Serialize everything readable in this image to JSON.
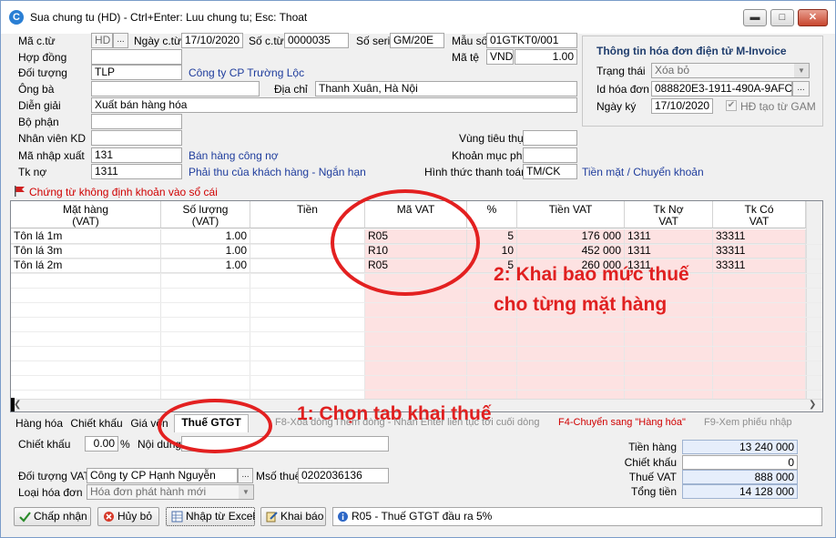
{
  "window": {
    "title": "Sua chung tu (HD) - Ctrl+Enter: Luu chung tu; Esc: Thoat",
    "min": "▬",
    "max": "□",
    "close": "✕"
  },
  "header": {
    "ma_ct_label": "Mã c.từ",
    "ma_ct_value": "HD",
    "dots": "...",
    "ngay_ct_label": "Ngày c.từ",
    "ngay_ct_value": "17/10/2020",
    "so_ct_label": "Số c.từ",
    "so_ct_value": "0000035",
    "so_seri_label": "Số seri",
    "so_seri_value": "GM/20E",
    "mau_so_label": "Mẫu số",
    "mau_so_value": "01GTKT0/001",
    "hop_dong_label": "Hợp đồng",
    "ma_te_label": "Mã tệ",
    "ma_te_value": "VND",
    "ty_gia_value": "1.00",
    "doi_tuong_label": "Đối tượng",
    "doi_tuong_value": "TLP",
    "doi_tuong_name": "Công ty CP Trường Lộc",
    "ong_ba_label": "Ông bà",
    "dia_chi_label": "Địa chỉ",
    "dia_chi_value": "Thanh Xuân, Hà Nội",
    "dien_giai_label": "Diễn giải",
    "dien_giai_value": "Xuất bán hàng hóa",
    "bo_phan_label": "Bộ phận",
    "nhan_vien_label": "Nhân viên KD",
    "vung_tieu_thu_label": "Vùng tiêu thụ",
    "ma_nhap_xuat_label": "Mã nhập xuất",
    "ma_nhap_xuat_value": "131",
    "ma_nhap_xuat_name": "Bán hàng công nợ",
    "khoan_muc_phi_label": "Khoản mục phí",
    "tk_no_label": "Tk nợ",
    "tk_no_value": "1311",
    "tk_no_name": "Phải thu của khách hàng - Ngắn hạn",
    "hinh_thuc_tt_label": "Hình thức thanh toán",
    "hinh_thuc_tt_value": "TM/CK",
    "hinh_thuc_tt_name": "Tiền mặt / Chuyển khoản"
  },
  "einvoice": {
    "title": "Thông tin hóa đơn điện tử M-Invoice",
    "trang_thai_label": "Trạng thái",
    "trang_thai_value": "Xóa bỏ",
    "id_label": "Id hóa đơn",
    "id_value": "088820E3-1911-490A-9AFC-9A",
    "ngay_ky_label": "Ngày ký",
    "ngay_ky_value": "17/10/2020",
    "hd_tao_label": "HĐ tạo từ GAM"
  },
  "warning": "Chứng từ không định khoản vào sổ cái",
  "grid": {
    "columns": [
      {
        "line1": "Mặt hàng",
        "line2": "(VAT)"
      },
      {
        "line1": "Số lượng",
        "line2": "(VAT)"
      },
      {
        "line1": "Tiền",
        "line2": ""
      },
      {
        "line1": "Mã VAT",
        "line2": ""
      },
      {
        "line1": "%",
        "line2": ""
      },
      {
        "line1": "Tiền VAT",
        "line2": ""
      },
      {
        "line1": "Tk Nợ",
        "line2": "VAT"
      },
      {
        "line1": "Tk Có",
        "line2": "VAT"
      }
    ],
    "rows": [
      {
        "mat_hang": "Tôn lá 1m",
        "so_luong": "1.00",
        "tien": "",
        "ma_vat": "R05",
        "pct": "5",
        "tien_vat": "176 000",
        "tk_no": "1311",
        "tk_co": "33311"
      },
      {
        "mat_hang": "Tôn lá 3m",
        "so_luong": "1.00",
        "tien": "",
        "ma_vat": "R10",
        "pct": "10",
        "tien_vat": "452 000",
        "tk_no": "1311",
        "tk_co": "33311"
      },
      {
        "mat_hang": "Tôn lá 2m",
        "so_luong": "1.00",
        "tien": "",
        "ma_vat": "R05",
        "pct": "5",
        "tien_vat": "260 000",
        "tk_no": "1311",
        "tk_co": "33311"
      }
    ]
  },
  "tabs": {
    "hang_hoa": "Hàng hóa",
    "chiet_khau": "Chiết khấu",
    "gia_von": "Giá vốn",
    "thue_gtgt": "Thuế GTGT",
    "f8": "F8-Xóa dòng",
    "themdong": "Thêm dòng - Nhấn Enter liên tục tới cuối dòng",
    "f4": "F4-Chuyển sang \"Hàng hóa\"",
    "f9": "F9-Xem phiếu nhập"
  },
  "tax_tab": {
    "chiet_khau_label": "Chiết khấu",
    "chiet_khau_value": "0.00",
    "pct": "%",
    "noi_dung_label": "Nội dung",
    "doi_tuong_vat_label": "Đối tượng VAT",
    "doi_tuong_vat_value": "Công ty CP Hạnh Nguyễn",
    "ms_thue_label": "Msố thuế",
    "ms_thue_value": "0202036136",
    "loai_hd_label": "Loại hóa đơn",
    "loai_hd_value": "Hóa đơn phát hành mới"
  },
  "totals": {
    "tien_hang_label": "Tiền hàng",
    "tien_hang_value": "13 240 000",
    "chiet_khau_label": "Chiết khấu",
    "chiet_khau_value": "0",
    "thue_vat_label": "Thuế VAT",
    "thue_vat_value": "888 000",
    "tong_tien_label": "Tổng tiền",
    "tong_tien_value": "14 128 000"
  },
  "buttons": {
    "accept": "Chấp nhận",
    "cancel": "Hủy bỏ",
    "import_excel": "Nhập từ Excel",
    "declare": "Khai báo"
  },
  "status": "R05 - Thuế GTGT đầu ra 5%",
  "annotations": {
    "step1": "1: Chọn tab khai thuế",
    "step2_line1": "2: Khai bao mức thuế",
    "step2_line2": "cho từng mặt hàng"
  },
  "colors": {
    "annotation": "#e02020",
    "link": "#1f3d9d",
    "vat_zone": "#fde2e2"
  }
}
